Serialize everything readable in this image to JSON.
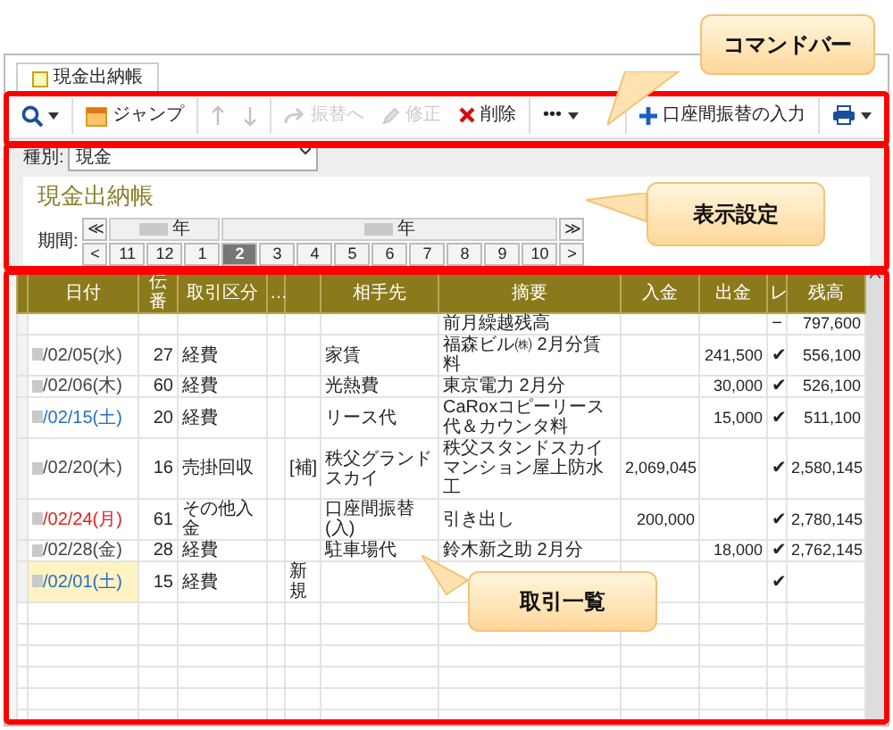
{
  "tab": {
    "label": "現金出納帳"
  },
  "toolbar": {
    "items": [
      {
        "kind": "search",
        "disabled": false
      },
      {
        "kind": "jump",
        "label": "ジャンプ",
        "disabled": false
      },
      {
        "kind": "up",
        "disabled": true
      },
      {
        "kind": "down",
        "disabled": true
      },
      {
        "kind": "transfer",
        "label": "振替へ",
        "disabled": true
      },
      {
        "kind": "edit",
        "label": "修正",
        "disabled": true
      },
      {
        "kind": "delete",
        "label": "削除",
        "disabled": false
      },
      {
        "kind": "more",
        "label": "•••",
        "disabled": false
      },
      {
        "kind": "add",
        "label": "口座間振替の入力",
        "disabled": false
      },
      {
        "kind": "print",
        "disabled": false
      }
    ]
  },
  "settings": {
    "type_label": "種別:",
    "type_value": "現金",
    "title": "現金出納帳",
    "period_label": "期間:",
    "year_prev": "≪",
    "years": [
      {
        "label": "年"
      },
      {
        "label": "年"
      }
    ],
    "year_next": "≫",
    "month_prev": "<",
    "months": [
      {
        "label": "11",
        "selected": false
      },
      {
        "label": "12",
        "selected": false
      },
      {
        "label": "1",
        "selected": false
      },
      {
        "label": "2",
        "selected": true
      },
      {
        "label": "3",
        "selected": false
      },
      {
        "label": "4",
        "selected": false
      },
      {
        "label": "5",
        "selected": false
      },
      {
        "label": "6",
        "selected": false
      },
      {
        "label": "7",
        "selected": false
      },
      {
        "label": "8",
        "selected": false
      },
      {
        "label": "9",
        "selected": false
      },
      {
        "label": "10",
        "selected": false
      }
    ],
    "month_next": ">"
  },
  "table": {
    "columns": [
      "日付",
      "伝番",
      "取引区分",
      "…",
      "",
      "相手先",
      "摘要",
      "入金",
      "出金",
      "レ",
      "残高"
    ],
    "rows": [
      {
        "new": false,
        "cells": [
          "",
          "",
          "",
          "",
          "",
          "",
          "前月繰越残高",
          "",
          "",
          "−",
          "797,600"
        ]
      },
      {
        "color": "#444444",
        "new": false,
        "cells": [
          "/02/05(水)",
          "27",
          "経費",
          "",
          "",
          "家賃",
          "福森ビル㈱ 2月分賃料",
          "",
          "241,500",
          "✔",
          "556,100"
        ]
      },
      {
        "color": "#444444",
        "new": false,
        "cells": [
          "/02/06(木)",
          "60",
          "経費",
          "",
          "",
          "光熱費",
          "東京電力 2月分",
          "",
          "30,000",
          "✔",
          "526,100"
        ]
      },
      {
        "color": "#2b6cc4",
        "new": false,
        "cells": [
          "/02/15(土)",
          "20",
          "経費",
          "",
          "",
          "リース代",
          "CaRoxコピーリース代＆カウンタ料",
          "",
          "15,000",
          "✔",
          "511,100"
        ]
      },
      {
        "color": "#444444",
        "new": false,
        "cells": [
          "/02/20(木)",
          "16",
          "売掛回収",
          "",
          "[補]",
          "秩父グランドスカイ",
          "秩父スタンドスカイマンション屋上防水工",
          "2,069,045",
          "",
          "✔",
          "2,580,145"
        ]
      },
      {
        "color": "#e02020",
        "new": false,
        "cells": [
          "/02/24(月)",
          "61",
          "その他入金",
          "",
          "",
          "口座間振替(入)",
          "引き出し",
          "200,000",
          "",
          "✔",
          "2,780,145"
        ]
      },
      {
        "color": "#444444",
        "new": false,
        "cells": [
          "/02/28(金)",
          "28",
          "経費",
          "",
          "",
          "駐車場代",
          "鈴木新之助 2月分",
          "",
          "18,000",
          "✔",
          "2,762,145"
        ]
      },
      {
        "color": "#2b6cc4",
        "new": true,
        "cells": [
          "/02/01(土)",
          "15",
          "経費",
          "",
          "新規",
          "",
          "",
          "",
          "",
          "✔",
          ""
        ]
      }
    ]
  },
  "callouts": [
    {
      "label": "コマンドバー"
    },
    {
      "label": "表示設定"
    },
    {
      "label": "取引一覧"
    }
  ]
}
